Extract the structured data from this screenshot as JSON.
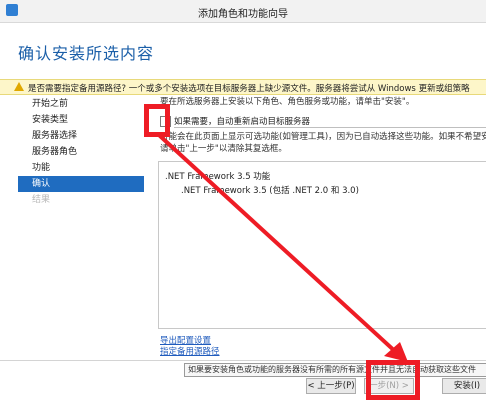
{
  "window": {
    "title": "添加角色和功能向导"
  },
  "page": {
    "title": "确认安装所选内容"
  },
  "warning": {
    "text": "是否需要指定备用源路径? 一个或多个安装选项在目标服务器上缺少源文件。服务器将尝试从 Windows 更新或组策略"
  },
  "nav": {
    "items": [
      {
        "label": "开始之前",
        "state": "normal"
      },
      {
        "label": "安装类型",
        "state": "normal"
      },
      {
        "label": "服务器选择",
        "state": "normal"
      },
      {
        "label": "服务器角色",
        "state": "normal"
      },
      {
        "label": "功能",
        "state": "normal"
      },
      {
        "label": "确认",
        "state": "active"
      },
      {
        "label": "结果",
        "state": "disabled"
      }
    ]
  },
  "content": {
    "intro": "要在所选服务器上安装以下角色、角色服务或功能，请单击\"安装\"。",
    "restart_label": "如果需要，自动重新启动目标服务器",
    "info_line1": "可能会在此页面上显示可选功能(如管理工具)，因为已自动选择这些功能。如果不希望安",
    "info_line2": "请单击\"上一步\"以清除其复选框。",
    "features": [
      ".NET Framework 3.5 功能",
      ".NET Framework 3.5 (包括 .NET 2.0 和 3.0)"
    ],
    "link_export": "导出配置设置",
    "link_alt_source": "指定备用源路径"
  },
  "tooltip": {
    "text": "如果要安装角色或功能的服务器没有所需的所有源文件并且无法自动获取这些文件"
  },
  "buttons": {
    "prev": "< 上一步(P)",
    "next": "一步(N) >",
    "install": "安装(I)"
  },
  "colors": {
    "accent": "#1f6cc0",
    "annotation": "#ee1c25",
    "warning_bg": "#fdf6c9"
  }
}
